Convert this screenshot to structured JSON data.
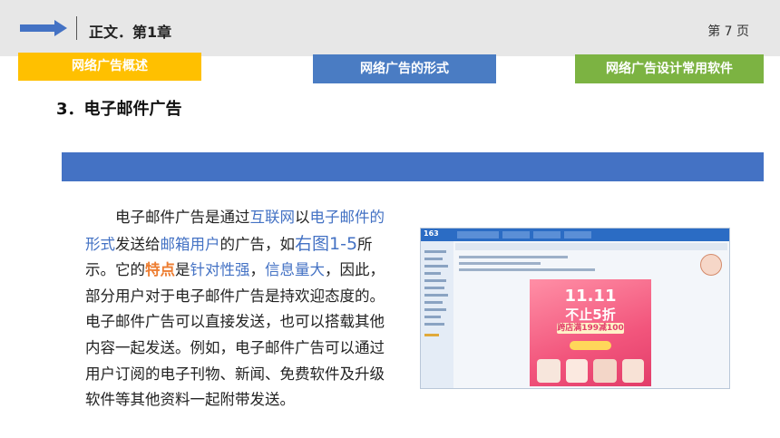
{
  "header": {
    "chapter": "正文．第1章",
    "page": "第 7 页"
  },
  "tabs": [
    {
      "label": "网络广告概述",
      "color": "#ffc000"
    },
    {
      "label": "网络广告的形式",
      "color": "#4a7cc3"
    },
    {
      "label": "网络广告设计常用软件",
      "color": "#7cb342"
    }
  ],
  "section": {
    "heading": "3．电子邮件广告"
  },
  "body": {
    "s1": "电子邮件广告是通过",
    "l1": "互联网",
    "s2": "以",
    "l2": "电子邮件的形式",
    "s3": "发送给",
    "l3": "邮箱用户",
    "s4": "的广告，如",
    "ref": "右图1-5",
    "s5": "所示。它的",
    "feature": "特点",
    "s6": "是",
    "l4": "针对性强",
    "s7": "，",
    "l5": "信息量大",
    "s8": "，因此，部分用户对于电子邮件广告是持欢迎态度的。电子邮件广告可以直接发送，也可以搭载其他内容一起发送。例如，电子邮件广告可以通过用户订阅的电子刊物、新闻、免费软件及升级软件等其他资料一起附带发送。"
  },
  "figure": {
    "mail_logo": "163",
    "ad_line1": "11.11",
    "ad_line2": "不止5折",
    "ad_line3": "跨店满199减100"
  },
  "colors": {
    "accent_blue": "#4472c4",
    "highlight": "#ed7d31"
  }
}
